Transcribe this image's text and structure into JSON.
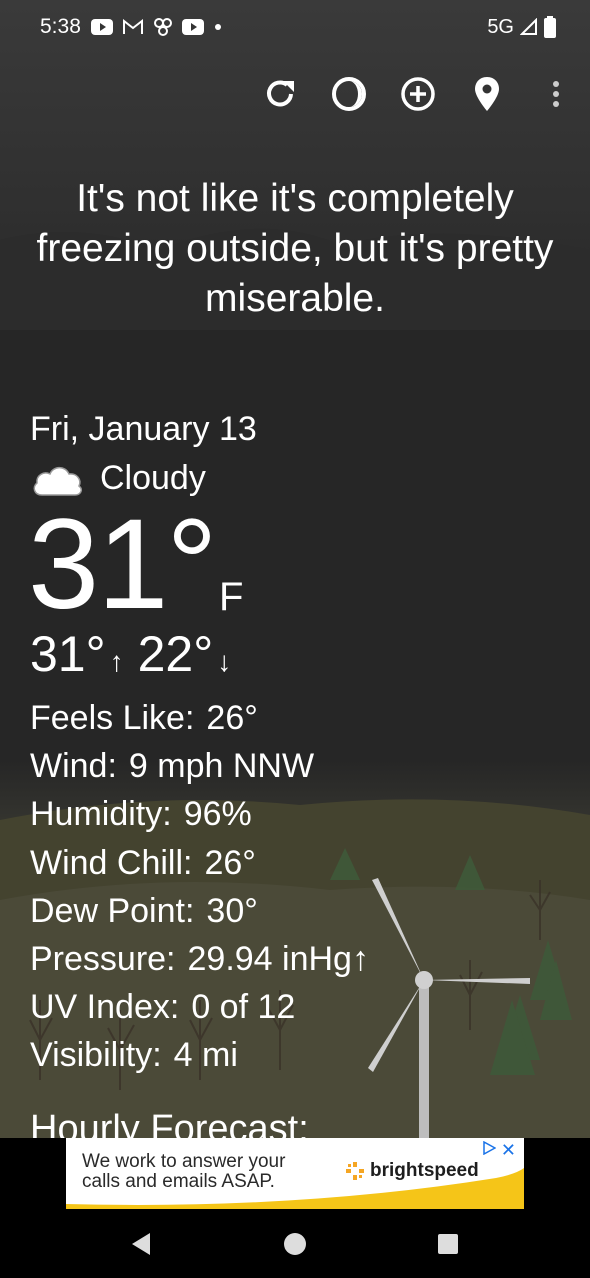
{
  "status_bar": {
    "time": "5:38",
    "network": "5G",
    "icons": [
      "youtube-icon",
      "gmail-icon",
      "pinwheel-icon",
      "youtube-icon",
      "dot-icon",
      "signal-icon",
      "battery-icon"
    ]
  },
  "toolbar": {
    "icons": [
      "refresh-icon",
      "moon-phase-icon",
      "add-location-icon",
      "location-pin-icon",
      "overflow-menu-icon"
    ]
  },
  "quip": "It's not like it's completely freezing outside, but it's pretty miserable.",
  "current": {
    "date": "Fri, January 13",
    "condition": "Cloudy",
    "condition_icon": "cloud-icon",
    "temp": "31°",
    "unit": "F",
    "high": "31°",
    "high_arrow": "↑",
    "low": "22°",
    "low_arrow": "↓"
  },
  "details": [
    {
      "label": "Feels Like:",
      "value": "26°"
    },
    {
      "label": "Wind:",
      "value": "9 mph NNW"
    },
    {
      "label": "Humidity:",
      "value": "96%"
    },
    {
      "label": "Wind Chill:",
      "value": "26°"
    },
    {
      "label": "Dew Point:",
      "value": "30°"
    },
    {
      "label": "Pressure:",
      "value": "29.94 inHg↑"
    },
    {
      "label": "UV Index:",
      "value": "0 of 12"
    },
    {
      "label": "Visibility:",
      "value": "4 mi"
    }
  ],
  "hourly_heading": "Hourly Forecast:",
  "ad": {
    "text_line1": "We work to answer your",
    "text_line2": "calls and emails ASAP.",
    "brand": "brightspeed",
    "close": "✕"
  },
  "colors": {
    "background": "#262626",
    "text": "#ffffff",
    "ad_accent": "#f5a623",
    "ad_close": "#1a73e8"
  }
}
